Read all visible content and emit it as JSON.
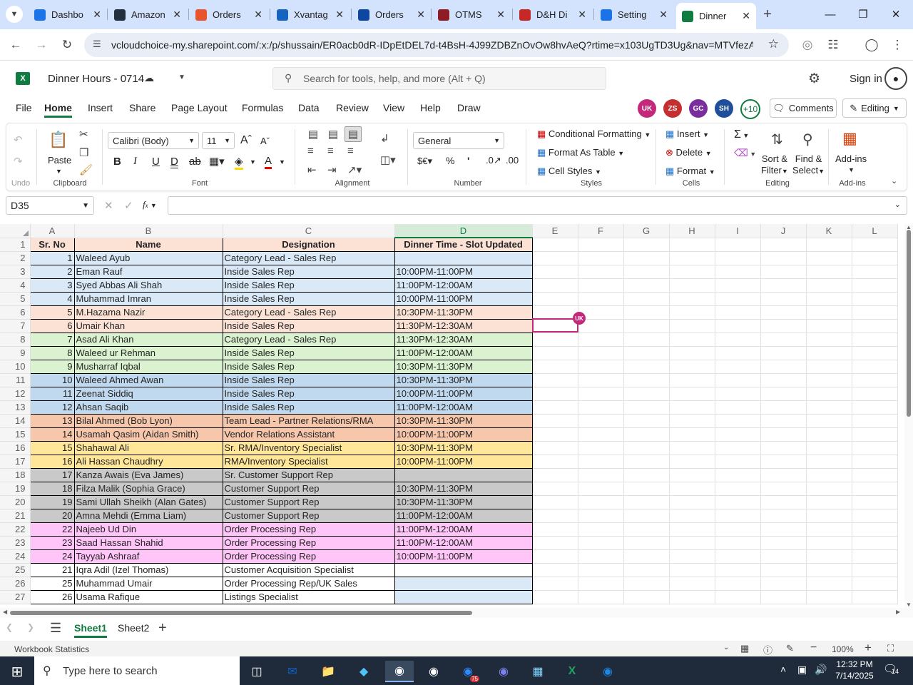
{
  "browser": {
    "tabs": [
      {
        "title": "Dashbo",
        "favicon_color": "#1a73e8"
      },
      {
        "title": "Amazon",
        "favicon_color": "#232f3e"
      },
      {
        "title": "Orders",
        "favicon_color": "#e8542d"
      },
      {
        "title": "Xvantag",
        "favicon_color": "#1565c0"
      },
      {
        "title": "Orders",
        "favicon_color": "#0d47a1"
      },
      {
        "title": "OTMS",
        "favicon_color": "#8d1c24"
      },
      {
        "title": "D&H Di",
        "favicon_color": "#c62828"
      },
      {
        "title": "Setting",
        "favicon_color": "#1a73e8"
      },
      {
        "title": "Dinner",
        "favicon_color": "#107c41"
      }
    ],
    "url": "vcloudchoice-my.sharepoint.com/:x:/p/shussain/ER0acb0dR-IDpEtDEL7d-t4BsH-4J99ZDBZnOvOw8hvAeQ?rtime=x103UgTD3Ug&nav=MTVfezA..."
  },
  "excel": {
    "doc_title": "Dinner Hours - 0714",
    "search_placeholder": "Search for tools, help, and more (Alt + Q)",
    "sign_in": "Sign in",
    "menu": [
      "File",
      "Home",
      "Insert",
      "Share",
      "Page Layout",
      "Formulas",
      "Data",
      "Review",
      "View",
      "Help",
      "Draw"
    ],
    "avatars": [
      {
        "initials": "UK",
        "color": "#c4287b"
      },
      {
        "initials": "ZS",
        "color": "#c43030"
      },
      {
        "initials": "GC",
        "color": "#7a2e9e"
      },
      {
        "initials": "SH",
        "color": "#1f4e9c"
      }
    ],
    "more_users": "+10",
    "comments": "Comments",
    "editing": "Editing",
    "ribbon": {
      "undo": "Undo",
      "paste": "Paste",
      "clipboard": "Clipboard",
      "font_name": "Calibri (Body)",
      "font_size": "11",
      "font": "Font",
      "alignment": "Alignment",
      "number_format": "General",
      "number": "Number",
      "conditional_formatting": "Conditional Formatting",
      "format_as_table": "Format As Table",
      "cell_styles": "Cell Styles",
      "styles": "Styles",
      "insert": "Insert",
      "delete": "Delete",
      "format": "Format",
      "cells": "Cells",
      "sort_filter_1": "Sort &",
      "sort_filter_2": "Filter",
      "find_select_1": "Find &",
      "find_select_2": "Select",
      "editing": "Editing",
      "addins": "Add-ins",
      "addins_group": "Add-ins"
    },
    "name_box": "D35",
    "formula": "",
    "columns": [
      "A",
      "B",
      "C",
      "D",
      "E",
      "F",
      "G",
      "H",
      "I",
      "J",
      "K",
      "L"
    ],
    "header_row": [
      "Sr. No",
      "Name",
      "Designation",
      "Dinner Time - Slot Updated"
    ],
    "rows": [
      {
        "r": "2",
        "sr": "1",
        "name": "Waleed Ayub",
        "desig": "Category Lead - Sales Rep",
        "time": "",
        "color": "#dae9f8"
      },
      {
        "r": "3",
        "sr": "2",
        "name": "Eman Rauf",
        "desig": "Inside Sales Rep",
        "time": "10:00PM-11:00PM",
        "color": "#dae9f8"
      },
      {
        "r": "4",
        "sr": "3",
        "name": "Syed Abbas Ali Shah",
        "desig": "Inside Sales Rep",
        "time": "11:00PM-12:00AM",
        "color": "#dae9f8"
      },
      {
        "r": "5",
        "sr": "4",
        "name": "Muhammad Imran",
        "desig": "Inside Sales Rep",
        "time": "10:00PM-11:00PM",
        "color": "#dae9f8"
      },
      {
        "r": "6",
        "sr": "5",
        "name": "M.Hazama Nazir",
        "desig": "Category Lead - Sales Rep",
        "time": "10:30PM-11:30PM",
        "color": "#fbe2d5"
      },
      {
        "r": "7",
        "sr": "6",
        "name": "Umair Khan",
        "desig": "Inside Sales Rep",
        "time": "11:30PM-12:30AM",
        "color": "#fbe2d5"
      },
      {
        "r": "8",
        "sr": "7",
        "name": "Asad Ali Khan",
        "desig": "Category Lead - Sales Rep",
        "time": "11:30PM-12:30AM",
        "color": "#daf2d0"
      },
      {
        "r": "9",
        "sr": "8",
        "name": "Waleed ur Rehman",
        "desig": "Inside Sales Rep",
        "time": "11:00PM-12:00AM",
        "color": "#daf2d0"
      },
      {
        "r": "10",
        "sr": "9",
        "name": "Musharraf Iqbal",
        "desig": "Inside Sales Rep",
        "time": "10:30PM-11:30PM",
        "color": "#daf2d0"
      },
      {
        "r": "11",
        "sr": "10",
        "name": "Waleed Ahmed Awan",
        "desig": "Inside Sales Rep",
        "time": "10:30PM-11:30PM",
        "color": "#c0d9ee"
      },
      {
        "r": "12",
        "sr": "11",
        "name": "Zeenat Siddiq",
        "desig": "Inside Sales Rep",
        "time": "10:00PM-11:00PM",
        "color": "#c0d9ee"
      },
      {
        "r": "13",
        "sr": "12",
        "name": "Ahsan Saqib",
        "desig": "Inside Sales Rep",
        "time": "11:00PM-12:00AM",
        "color": "#c0d9ee"
      },
      {
        "r": "14",
        "sr": "13",
        "name": "Bilal Ahmed (Bob Lyon)",
        "desig": "Team Lead - Partner Relations/RMA",
        "time": "10:30PM-11:30PM",
        "color": "#f7c7ac"
      },
      {
        "r": "15",
        "sr": "14",
        "name": "Usamah Qasim (Aidan Smith)",
        "desig": "Vendor Relations Assistant",
        "time": "10:00PM-11:00PM",
        "color": "#f7c7ac"
      },
      {
        "r": "16",
        "sr": "15",
        "name": "Shahawal Ali",
        "desig": "Sr. RMA/Inventory Specialist",
        "time": "10:30PM-11:30PM",
        "color": "#ffe699"
      },
      {
        "r": "17",
        "sr": "16",
        "name": "Ali Hassan Chaudhry",
        "desig": "RMA/Inventory Specialist",
        "time": "10:00PM-11:00PM",
        "color": "#ffe699"
      },
      {
        "r": "18",
        "sr": "17",
        "name": "Kanza Awais (Eva James)",
        "desig": "Sr. Customer Support Rep",
        "time": "",
        "color": "#c9c9c9"
      },
      {
        "r": "19",
        "sr": "18",
        "name": "Filza Malik (Sophia Grace)",
        "desig": "Customer Support Rep",
        "time": "10:30PM-11:30PM",
        "color": "#c9c9c9"
      },
      {
        "r": "20",
        "sr": "19",
        "name": "Sami Ullah Sheikh (Alan Gates)",
        "desig": "Customer Support Rep",
        "time": "10:30PM-11:30PM",
        "color": "#c9c9c9"
      },
      {
        "r": "21",
        "sr": "20",
        "name": "Amna Mehdi (Emma Liam)",
        "desig": "Customer Support Rep",
        "time": "11:00PM-12:00AM",
        "color": "#c9c9c9"
      },
      {
        "r": "22",
        "sr": "22",
        "name": "Najeeb Ud Din",
        "desig": "Order Processing Rep",
        "time": "11:00PM-12:00AM",
        "color": "#ffc5f9"
      },
      {
        "r": "23",
        "sr": "23",
        "name": "Saad Hassan Shahid",
        "desig": "Order Processing Rep",
        "time": "11:00PM-12:00AM",
        "color": "#ffc5f9"
      },
      {
        "r": "24",
        "sr": "24",
        "name": "Tayyab Ashraaf",
        "desig": "Order Processing Rep",
        "time": "10:00PM-11:00PM",
        "color": "#ffc5f9"
      },
      {
        "r": "25",
        "sr": "21",
        "name": "Iqra Adil (Izel Thomas)",
        "desig": "Customer Acquisition Specialist",
        "time": "",
        "color": "#ffffff"
      },
      {
        "r": "26",
        "sr": "25",
        "name": "Muhammad Umair",
        "desig": "Order Processing Rep/UK Sales",
        "time": "",
        "color": "#ffffff",
        "dcolor": "#dae9f8"
      },
      {
        "r": "27",
        "sr": "26",
        "name": "Usama Rafique",
        "desig": "Listings Specialist",
        "time": "",
        "color": "#ffffff",
        "dcolor": "#dae9f8"
      }
    ],
    "header_color": "#fbe2d5",
    "cursor_user": "UK",
    "sheets": [
      "Sheet1",
      "Sheet2"
    ],
    "status_left": "Workbook Statistics",
    "zoom": "100%"
  },
  "taskbar": {
    "search_placeholder": "Type here to search",
    "time": "12:32 PM",
    "date": "7/14/2025",
    "notif_count": "14",
    "zoom_badge": "75"
  }
}
